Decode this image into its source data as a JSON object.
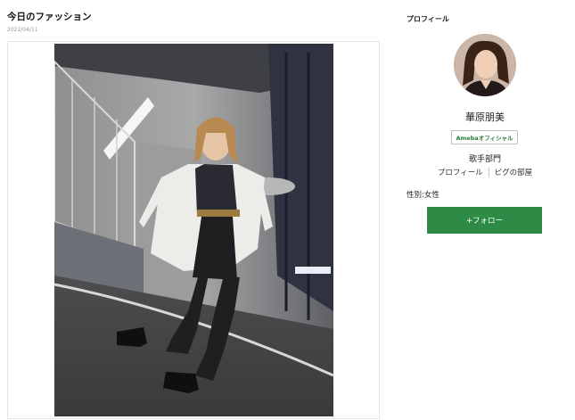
{
  "post": {
    "title": "今日のファッション",
    "date": "2022/04/11"
  },
  "sidebar": {
    "heading": "プロフィール",
    "name": "華原朋美",
    "badge": "Amebaオフィシャル",
    "category": "歌手部門",
    "links": [
      "プロフィール",
      "ピグの部屋"
    ],
    "gender": "性別:女性",
    "follow_label": "+フォロー"
  },
  "colors": {
    "follow_button": "#2e8b45",
    "badge_text": "#2c7a3f"
  }
}
